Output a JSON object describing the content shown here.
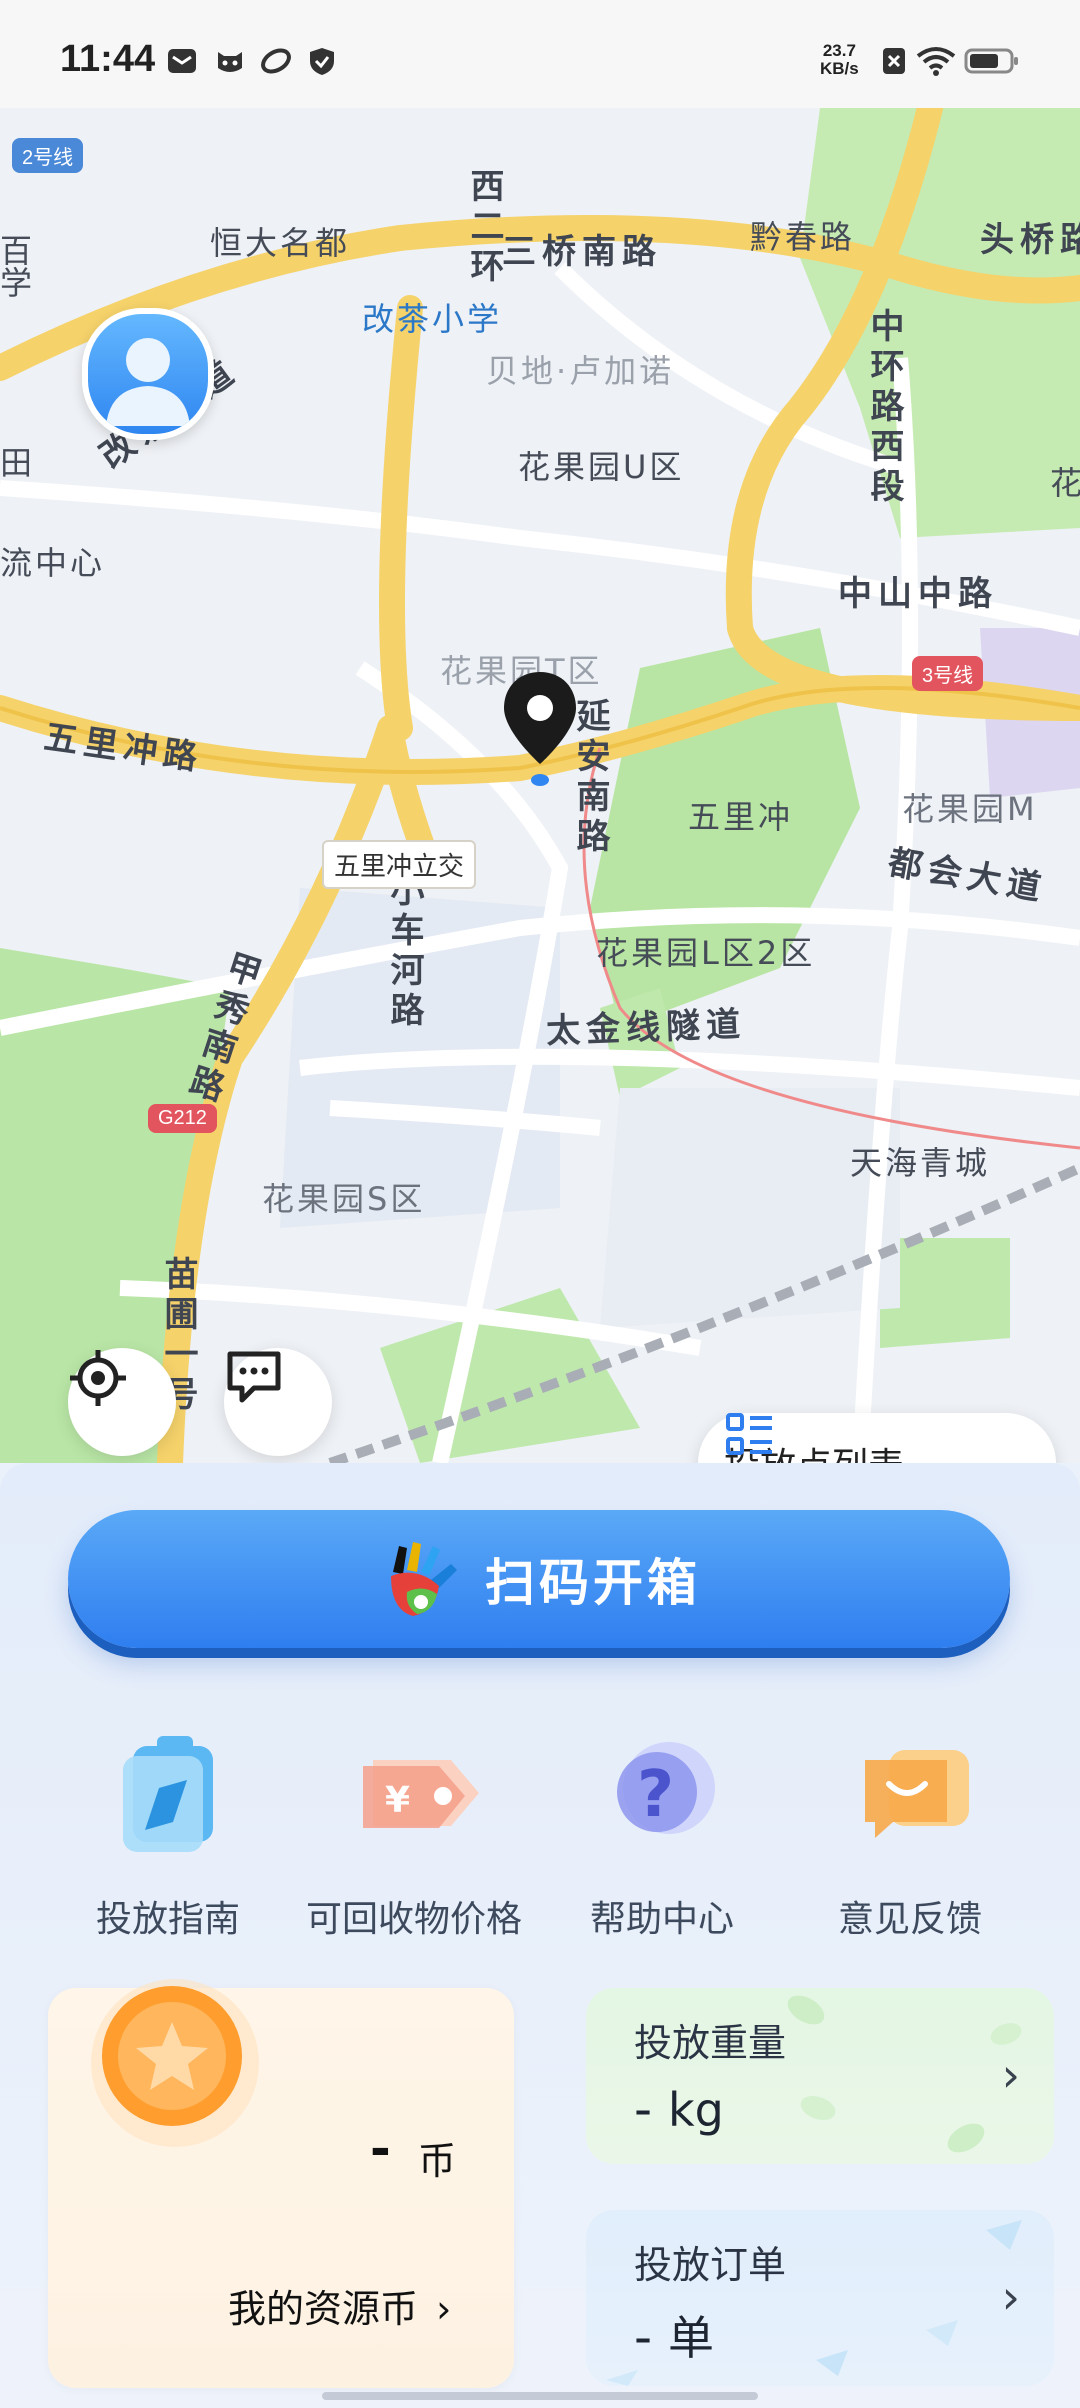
{
  "status_bar": {
    "time": "11:44",
    "net_speed_value": "23.7",
    "net_speed_unit": "KB/s",
    "icons": [
      "mail-icon",
      "cat-face-icon",
      "leaf-icon",
      "shield-icon",
      "no-sim-icon",
      "wifi-icon",
      "battery-icon"
    ]
  },
  "map": {
    "labels": {
      "line2": "2号线",
      "line3": "3号线",
      "g212": "G212",
      "dadi": "恒大名都",
      "gaicha_school": "改茶小学",
      "beidi": "贝地·卢加诺",
      "huaguoyuan_u": "花果园U区",
      "liu_center": "流中心",
      "huaguoyuan_t": "花果园T区",
      "wulichong_station": "五里冲",
      "huaguoyuan_m": "花果园M",
      "huaguoyuan_l2": "花果园L区2区",
      "huaguoyuan_s": "花果园S区",
      "tianhai": "天海青城",
      "qianchun": "黔春路",
      "hua_edge": "花",
      "tian_edge": "田",
      "wen_edge": "百",
      "xue_edge": "学"
    },
    "roads": {
      "xierhuan": "西二环",
      "sanqiao": "三桥南路",
      "touqiao": "头桥路",
      "gaicha": "改茶大道",
      "zhonghuan": "中环路西段",
      "zhongshan": "中山中路",
      "wulichong_road": "五里冲路",
      "yanan": "延安南路",
      "dushi": "都会大道",
      "tianxiu": "甲秀南路",
      "xiaochehe": "小车河路",
      "taijin": "太金线隧道",
      "miaopu": "苗圃一号"
    },
    "intersection": "五里冲立交",
    "list_button_label": "投放点列表"
  },
  "scan_button_label": "扫码开箱",
  "quick_actions": [
    {
      "label": "投放指南"
    },
    {
      "label": "可回收物价格"
    },
    {
      "label": "帮助中心"
    },
    {
      "label": "意见反馈"
    }
  ],
  "coin_card": {
    "value": "-",
    "unit": "币",
    "link_label": "我的资源币"
  },
  "weight_card": {
    "title": "投放重量",
    "value": "-",
    "unit": "kg"
  },
  "orders_card": {
    "title": "投放订单",
    "value": "-",
    "unit": "单"
  },
  "colors": {
    "accent_blue": "#2f7ef0",
    "road_yellow": "#f5d26a",
    "park_green": "#b9e6a6",
    "coin_orange": "#ff9d2e"
  }
}
